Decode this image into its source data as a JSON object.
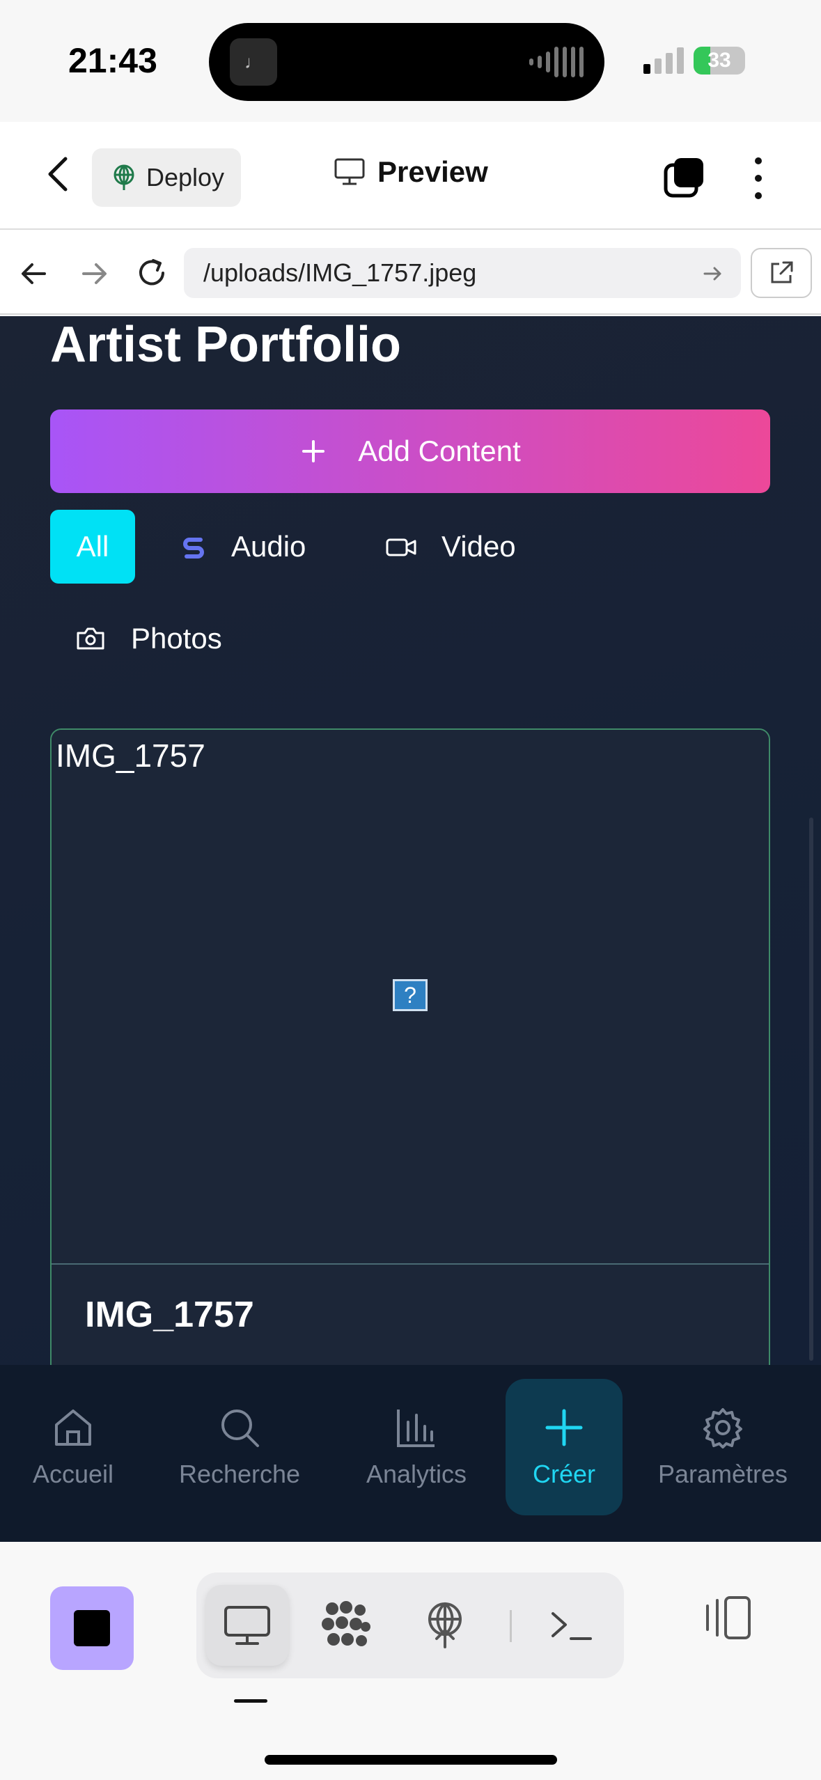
{
  "status_bar": {
    "time": "21:43",
    "battery": "33",
    "battery_level": 0.33
  },
  "toolbar": {
    "deploy_label": "Deploy",
    "preview_label": "Preview"
  },
  "url_bar": {
    "url": "/uploads/IMG_1757.jpeg"
  },
  "main": {
    "title": "Artist Portfolio",
    "add_button_label": "Add Content",
    "filters": [
      {
        "label": "All",
        "icon": "none",
        "active": true
      },
      {
        "label": "Audio",
        "icon": "spotify-s-icon",
        "active": false
      },
      {
        "label": "Video",
        "icon": "video-camera-icon",
        "active": false
      },
      {
        "label": "Photos",
        "icon": "camera-icon",
        "active": false
      }
    ],
    "card": {
      "image_alt": "IMG_1757",
      "broken_glyph": "?",
      "title": "IMG_1757"
    }
  },
  "bottom_nav": {
    "items": [
      {
        "label": "Accueil",
        "icon": "home-icon",
        "active": false
      },
      {
        "label": "Recherche",
        "icon": "search-icon",
        "active": false
      },
      {
        "label": "Analytics",
        "icon": "bar-chart-icon",
        "active": false
      },
      {
        "label": "Créer",
        "icon": "plus-icon",
        "active": true
      },
      {
        "label": "Paramètres",
        "icon": "gear-icon",
        "active": false
      }
    ]
  },
  "dock": {
    "terminal_glyph": ">_",
    "items": [
      "monitor-icon",
      "dots-cluster-icon",
      "deploy-icon",
      "terminal-icon"
    ]
  },
  "colors": {
    "accent_cyan": "#00e1f5",
    "gradient_start": "#a855f7",
    "gradient_end": "#ec4899",
    "nav_active": "#20d6f2",
    "stop_button": "#b8a5ff"
  }
}
